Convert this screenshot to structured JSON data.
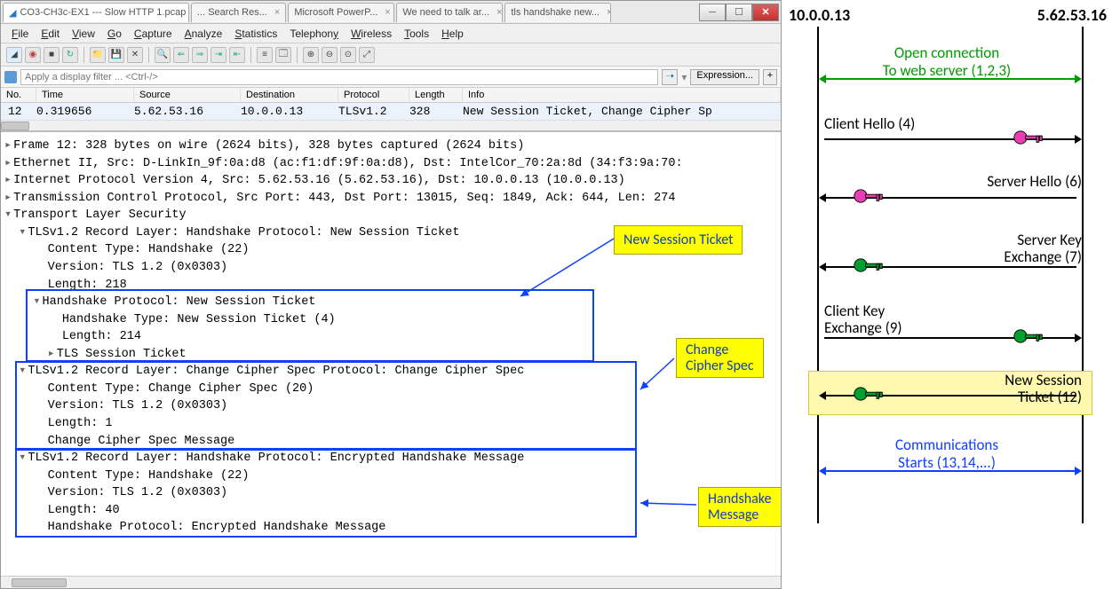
{
  "window": {
    "title": "CO3-CH3c-EX1 --- Slow HTTP 1.pcap",
    "tabs": [
      "CO3-CH3c-EX1 --- Slow HTTP 1.pcap",
      "... Search Res...",
      "Microsoft PowerP...",
      "We need to talk ar...",
      "tls handshake new..."
    ]
  },
  "menu": {
    "items": [
      "File",
      "Edit",
      "View",
      "Go",
      "Capture",
      "Analyze",
      "Statistics",
      "Telephony",
      "Wireless",
      "Tools",
      "Help"
    ]
  },
  "filter": {
    "placeholder": "Apply a display filter ... <Ctrl-/>",
    "expression": "Expression..."
  },
  "packet_list": {
    "headers": [
      "No.",
      "Time",
      "Source",
      "Destination",
      "Protocol",
      "Length",
      "Info"
    ],
    "row": {
      "no": "12",
      "time": "0.319656",
      "src": "5.62.53.16",
      "dst": "10.0.0.13",
      "proto": "TLSv1.2",
      "len": "328",
      "info": "New Session Ticket, Change Cipher Sp"
    }
  },
  "details": {
    "l0": "Frame 12: 328 bytes on wire (2624 bits), 328 bytes captured (2624 bits)",
    "l1": "Ethernet II, Src: D-LinkIn_9f:0a:d8 (ac:f1:df:9f:0a:d8), Dst: IntelCor_70:2a:8d (34:f3:9a:70:",
    "l2": "Internet Protocol Version 4, Src: 5.62.53.16 (5.62.53.16), Dst: 10.0.0.13 (10.0.0.13)",
    "l3": "Transmission Control Protocol, Src Port: 443, Dst Port: 13015, Seq: 1849, Ack: 644, Len: 274",
    "l4": "Transport Layer Security",
    "l5": "TLSv1.2 Record Layer: Handshake Protocol: New Session Ticket",
    "l6": "Content Type: Handshake (22)",
    "l7": "Version: TLS 1.2 (0x0303)",
    "l8": "Length: 218",
    "l9": "Handshake Protocol: New Session Ticket",
    "l10": "Handshake Type: New Session Ticket (4)",
    "l11": "Length: 214",
    "l12": "TLS Session Ticket",
    "l13": "TLSv1.2 Record Layer: Change Cipher Spec Protocol: Change Cipher Spec",
    "l14": "Content Type: Change Cipher Spec (20)",
    "l15": "Version: TLS 1.2 (0x0303)",
    "l16": "Length: 1",
    "l17": "Change Cipher Spec Message",
    "l18": "TLSv1.2 Record Layer: Handshake Protocol: Encrypted Handshake Message",
    "l19": "Content Type: Handshake (22)",
    "l20": "Version: TLS 1.2 (0x0303)",
    "l21": "Length: 40",
    "l22": "Handshake Protocol: Encrypted Handshake Message"
  },
  "callouts": {
    "c1": "New Session Ticket",
    "c2a": "Change",
    "c2b": "Cipher Spec",
    "c3a": "Handshake",
    "c3b": "Message"
  },
  "diagram": {
    "endpoint_left": "10.0.0.13",
    "endpoint_right": "5.62.53.16",
    "open1": "Open connection",
    "open2": "To web server (1,2,3)",
    "clienthello": "Client Hello (4)",
    "serverhello": "Server Hello (6)",
    "srvkey1": "Server Key",
    "srvkey2": "Exchange (7)",
    "clikey1": "Client Key",
    "clikey2": "Exchange (9)",
    "newsess1": "New Session",
    "newsess2": "Ticket (12)",
    "comm1": "Communications",
    "comm2": "Starts (13,14,...)"
  }
}
